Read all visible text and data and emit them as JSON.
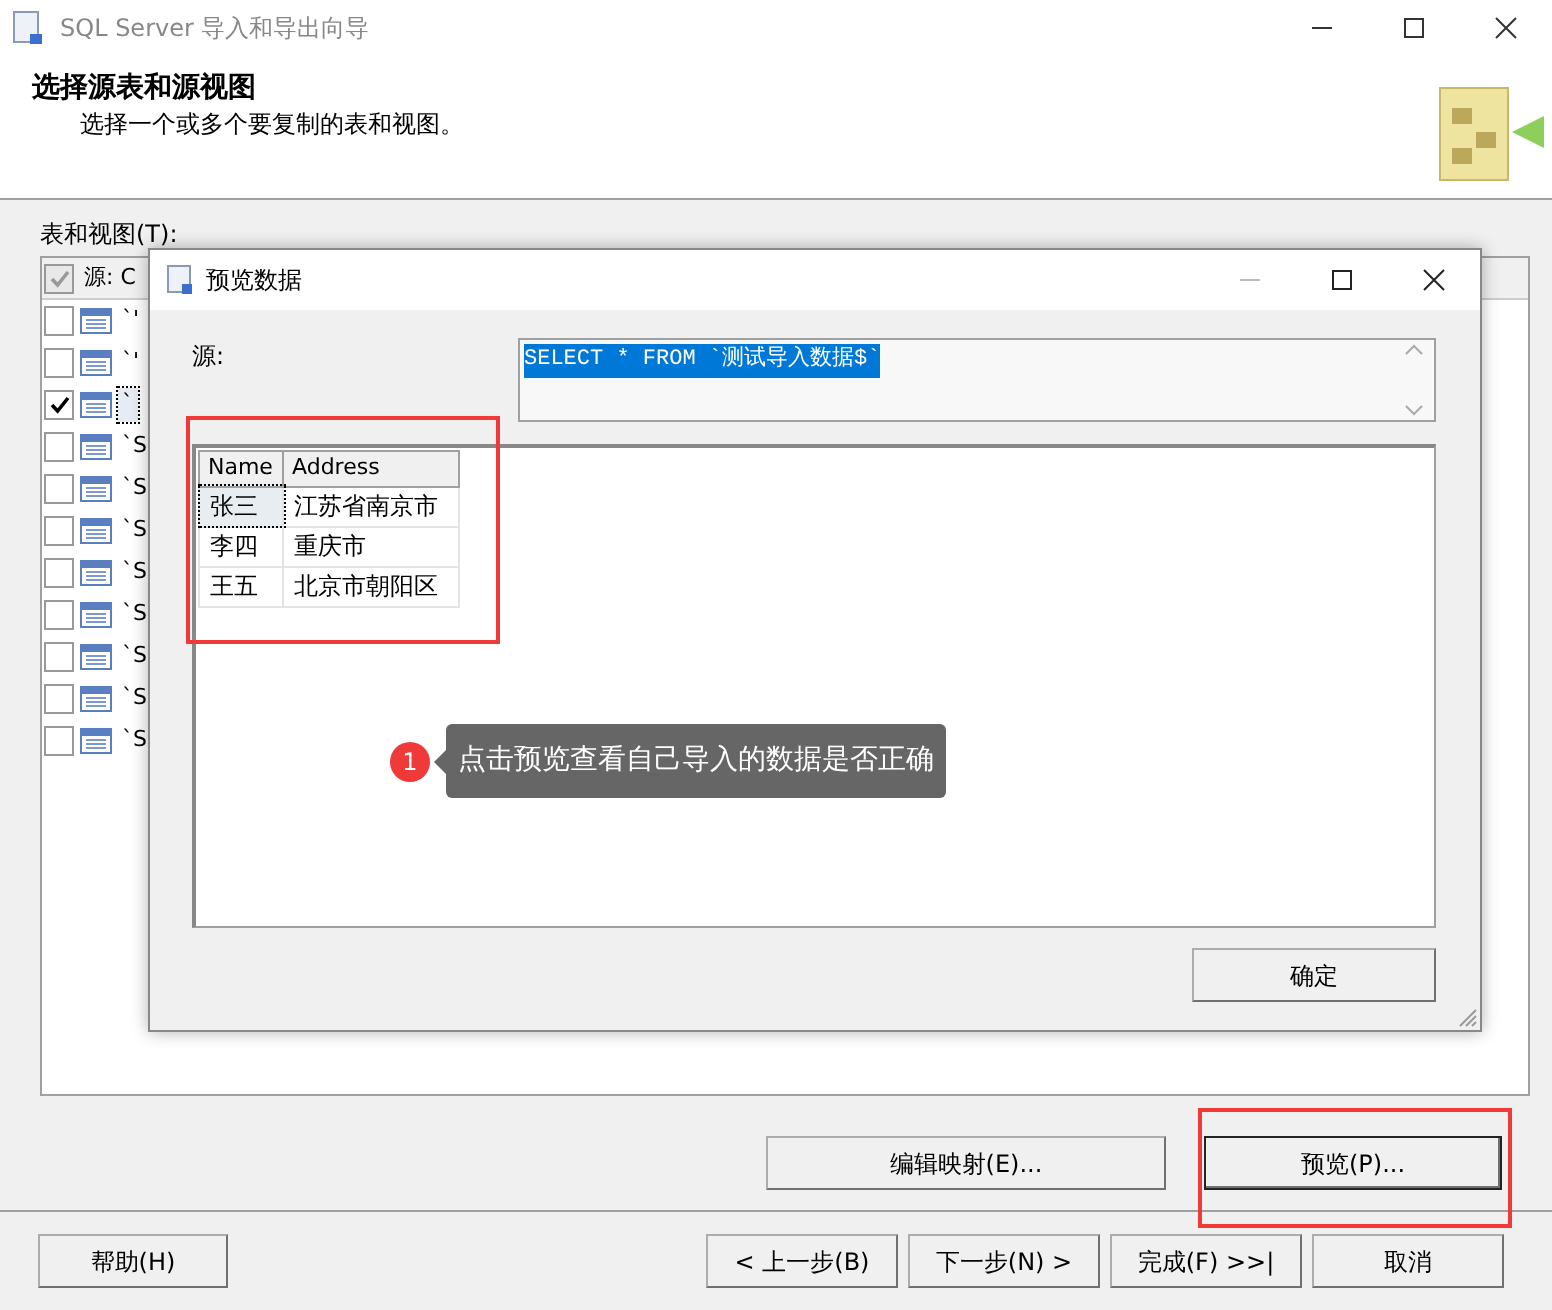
{
  "window": {
    "title": "SQL Server 导入和导出向导"
  },
  "header": {
    "title": "选择源表和源视图",
    "subtitle": "选择一个或多个要复制的表和视图。"
  },
  "tables_label": "表和视图(T):",
  "tables": {
    "header": {
      "source": "源: C",
      "checked": true,
      "disabled": true
    },
    "rows": [
      {
        "source": "`'",
        "checked": false,
        "selected": false
      },
      {
        "source": "`'",
        "checked": false,
        "selected": false
      },
      {
        "source": "`",
        "checked": true,
        "selected": true
      },
      {
        "source": "`S",
        "checked": false,
        "selected": false
      },
      {
        "source": "`S",
        "checked": false,
        "selected": false
      },
      {
        "source": "`S",
        "checked": false,
        "selected": false
      },
      {
        "source": "`S",
        "checked": false,
        "selected": false
      },
      {
        "source": "`S",
        "checked": false,
        "selected": false
      },
      {
        "source": "`S",
        "checked": false,
        "selected": false
      },
      {
        "source": "`S",
        "checked": false,
        "selected": false
      },
      {
        "source": "`S",
        "checked": false,
        "selected": false
      }
    ]
  },
  "mid_buttons": [
    {
      "label": "编辑映射(E)...",
      "highlighted": false
    },
    {
      "label": "预览(P)...",
      "highlighted": true
    }
  ],
  "help_button": "帮助(H)",
  "nav_buttons": [
    "< 上一步(B)",
    "下一步(N) >",
    "完成(F) >>|",
    "取消"
  ],
  "preview_dialog": {
    "title": "预览数据",
    "source_label": "源:",
    "query": {
      "text": "SELECT * FROM `测试导入数据$`",
      "selected": true
    },
    "grid": {
      "highlighted": true,
      "columns": [
        "Name",
        "Address"
      ],
      "rows": [
        [
          "张三",
          "江苏省南京市"
        ],
        [
          "李四",
          "重庆市"
        ],
        [
          "王五",
          "北京市朝阳区"
        ]
      ]
    },
    "ok_button": "确定"
  },
  "annotation": {
    "number": "1",
    "text": "点击预览查看自己导入的数据是否正确"
  }
}
